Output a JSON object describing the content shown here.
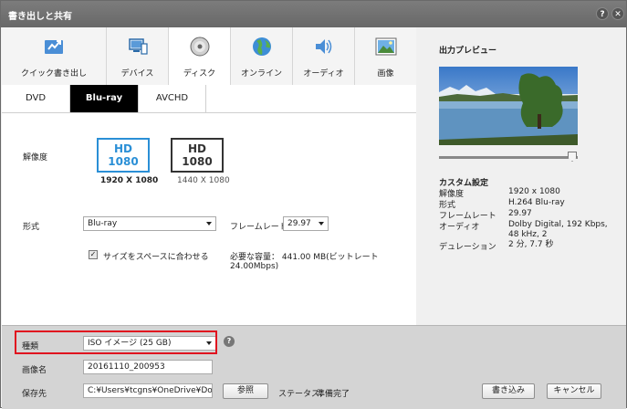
{
  "window": {
    "title": "書き出しと共有",
    "help_label": "?",
    "close_label": "✕"
  },
  "tabs": [
    {
      "label": "クイック書き出し",
      "icon": "quick-export-icon"
    },
    {
      "label": "デバイス",
      "icon": "device-icon"
    },
    {
      "label": "ディスク",
      "icon": "disc-icon"
    },
    {
      "label": "オンライン",
      "icon": "globe-icon"
    },
    {
      "label": "オーディオ",
      "icon": "speaker-icon"
    },
    {
      "label": "画像",
      "icon": "image-icon"
    }
  ],
  "active_tab": "ディスク",
  "subtabs": [
    {
      "label": "DVD"
    },
    {
      "label": "Blu-ray"
    },
    {
      "label": "AVCHD"
    }
  ],
  "active_subtab": "Blu-ray",
  "resolution": {
    "label": "解像度",
    "options": [
      {
        "line1": "HD",
        "line2": "1080",
        "caption": "1920 X 1080",
        "selected": true
      },
      {
        "line1": "HD",
        "line2": "1080",
        "caption": "1440 X 1080",
        "selected": false
      }
    ]
  },
  "format": {
    "label": "形式",
    "value": "Blu-ray"
  },
  "frame_rate": {
    "label": "フレームレート",
    "value": "29.97"
  },
  "fit_to_space": {
    "label": "サイズをスペースに合わせる",
    "checked": true,
    "check_mark": "✓"
  },
  "required_space": "必要な容量： 441.00 MB(ビットレート 24.00Mbps)",
  "preview": {
    "title": "出力プレビュー"
  },
  "custom_settings": {
    "title": "カスタム設定",
    "rows": [
      {
        "key": "解像度",
        "value": "1920 x 1080"
      },
      {
        "key": "形式",
        "value": "H.264 Blu-ray"
      },
      {
        "key": "フレームレート",
        "value": "29.97"
      },
      {
        "key": "オーディオ",
        "value": "Dolby Digital, 192 Kbps, 48 kHz, 2"
      },
      {
        "key": "デュレーション",
        "value": "2 分, 7.7 秒"
      }
    ]
  },
  "bottom": {
    "type_label": "種類",
    "type_value": "ISO イメージ (25 GB)",
    "help_label": "?",
    "image_name_label": "画像名",
    "image_name_value": "20161110_200953",
    "save_to_label": "保存先",
    "save_to_value": "C:¥Users¥tcgns¥OneDrive¥Document",
    "browse_label": "参照",
    "status_label": "ステータス：",
    "status_value": "準備完了",
    "write_label": "書き込み",
    "cancel_label": "キャンセル"
  },
  "colors": {
    "highlight": "#e0121f",
    "hd_selected": "#2a8fd6",
    "hd_unselected": "#333333",
    "active_subtab_bg": "#000000"
  }
}
